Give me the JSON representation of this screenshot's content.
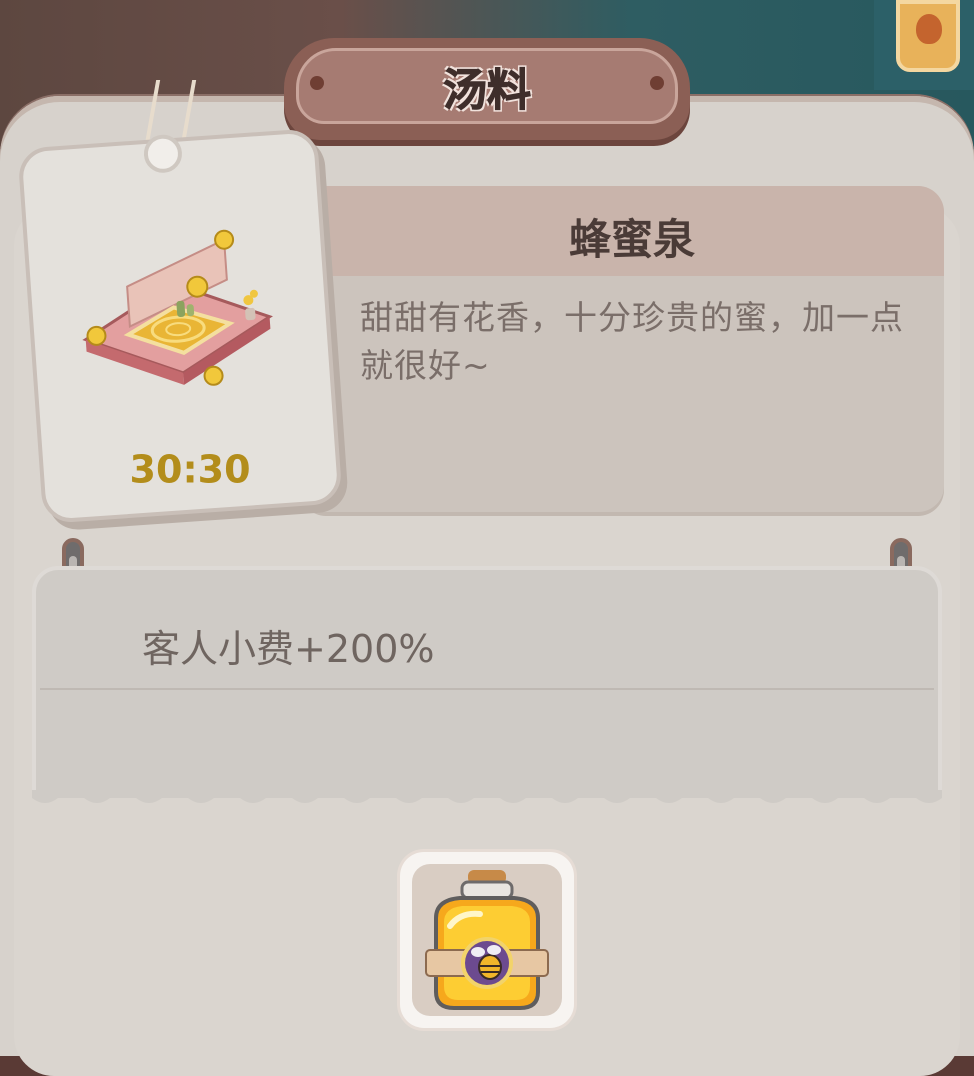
{
  "panel": {
    "title": "汤料"
  },
  "item": {
    "name": "蜂蜜泉",
    "description": "甜甜有花香，十分珍贵的蜜，加一点就很好~",
    "timer": "30:30"
  },
  "effect": {
    "text": "客人小费+200%"
  },
  "ingredient": {
    "icon": "honey-jar-icon"
  },
  "colors": {
    "panel_bg": "#d7d2cc",
    "title_plate": "#a67b72",
    "timer_gold": "#b38d1b",
    "text_brown": "#4a3b37"
  }
}
